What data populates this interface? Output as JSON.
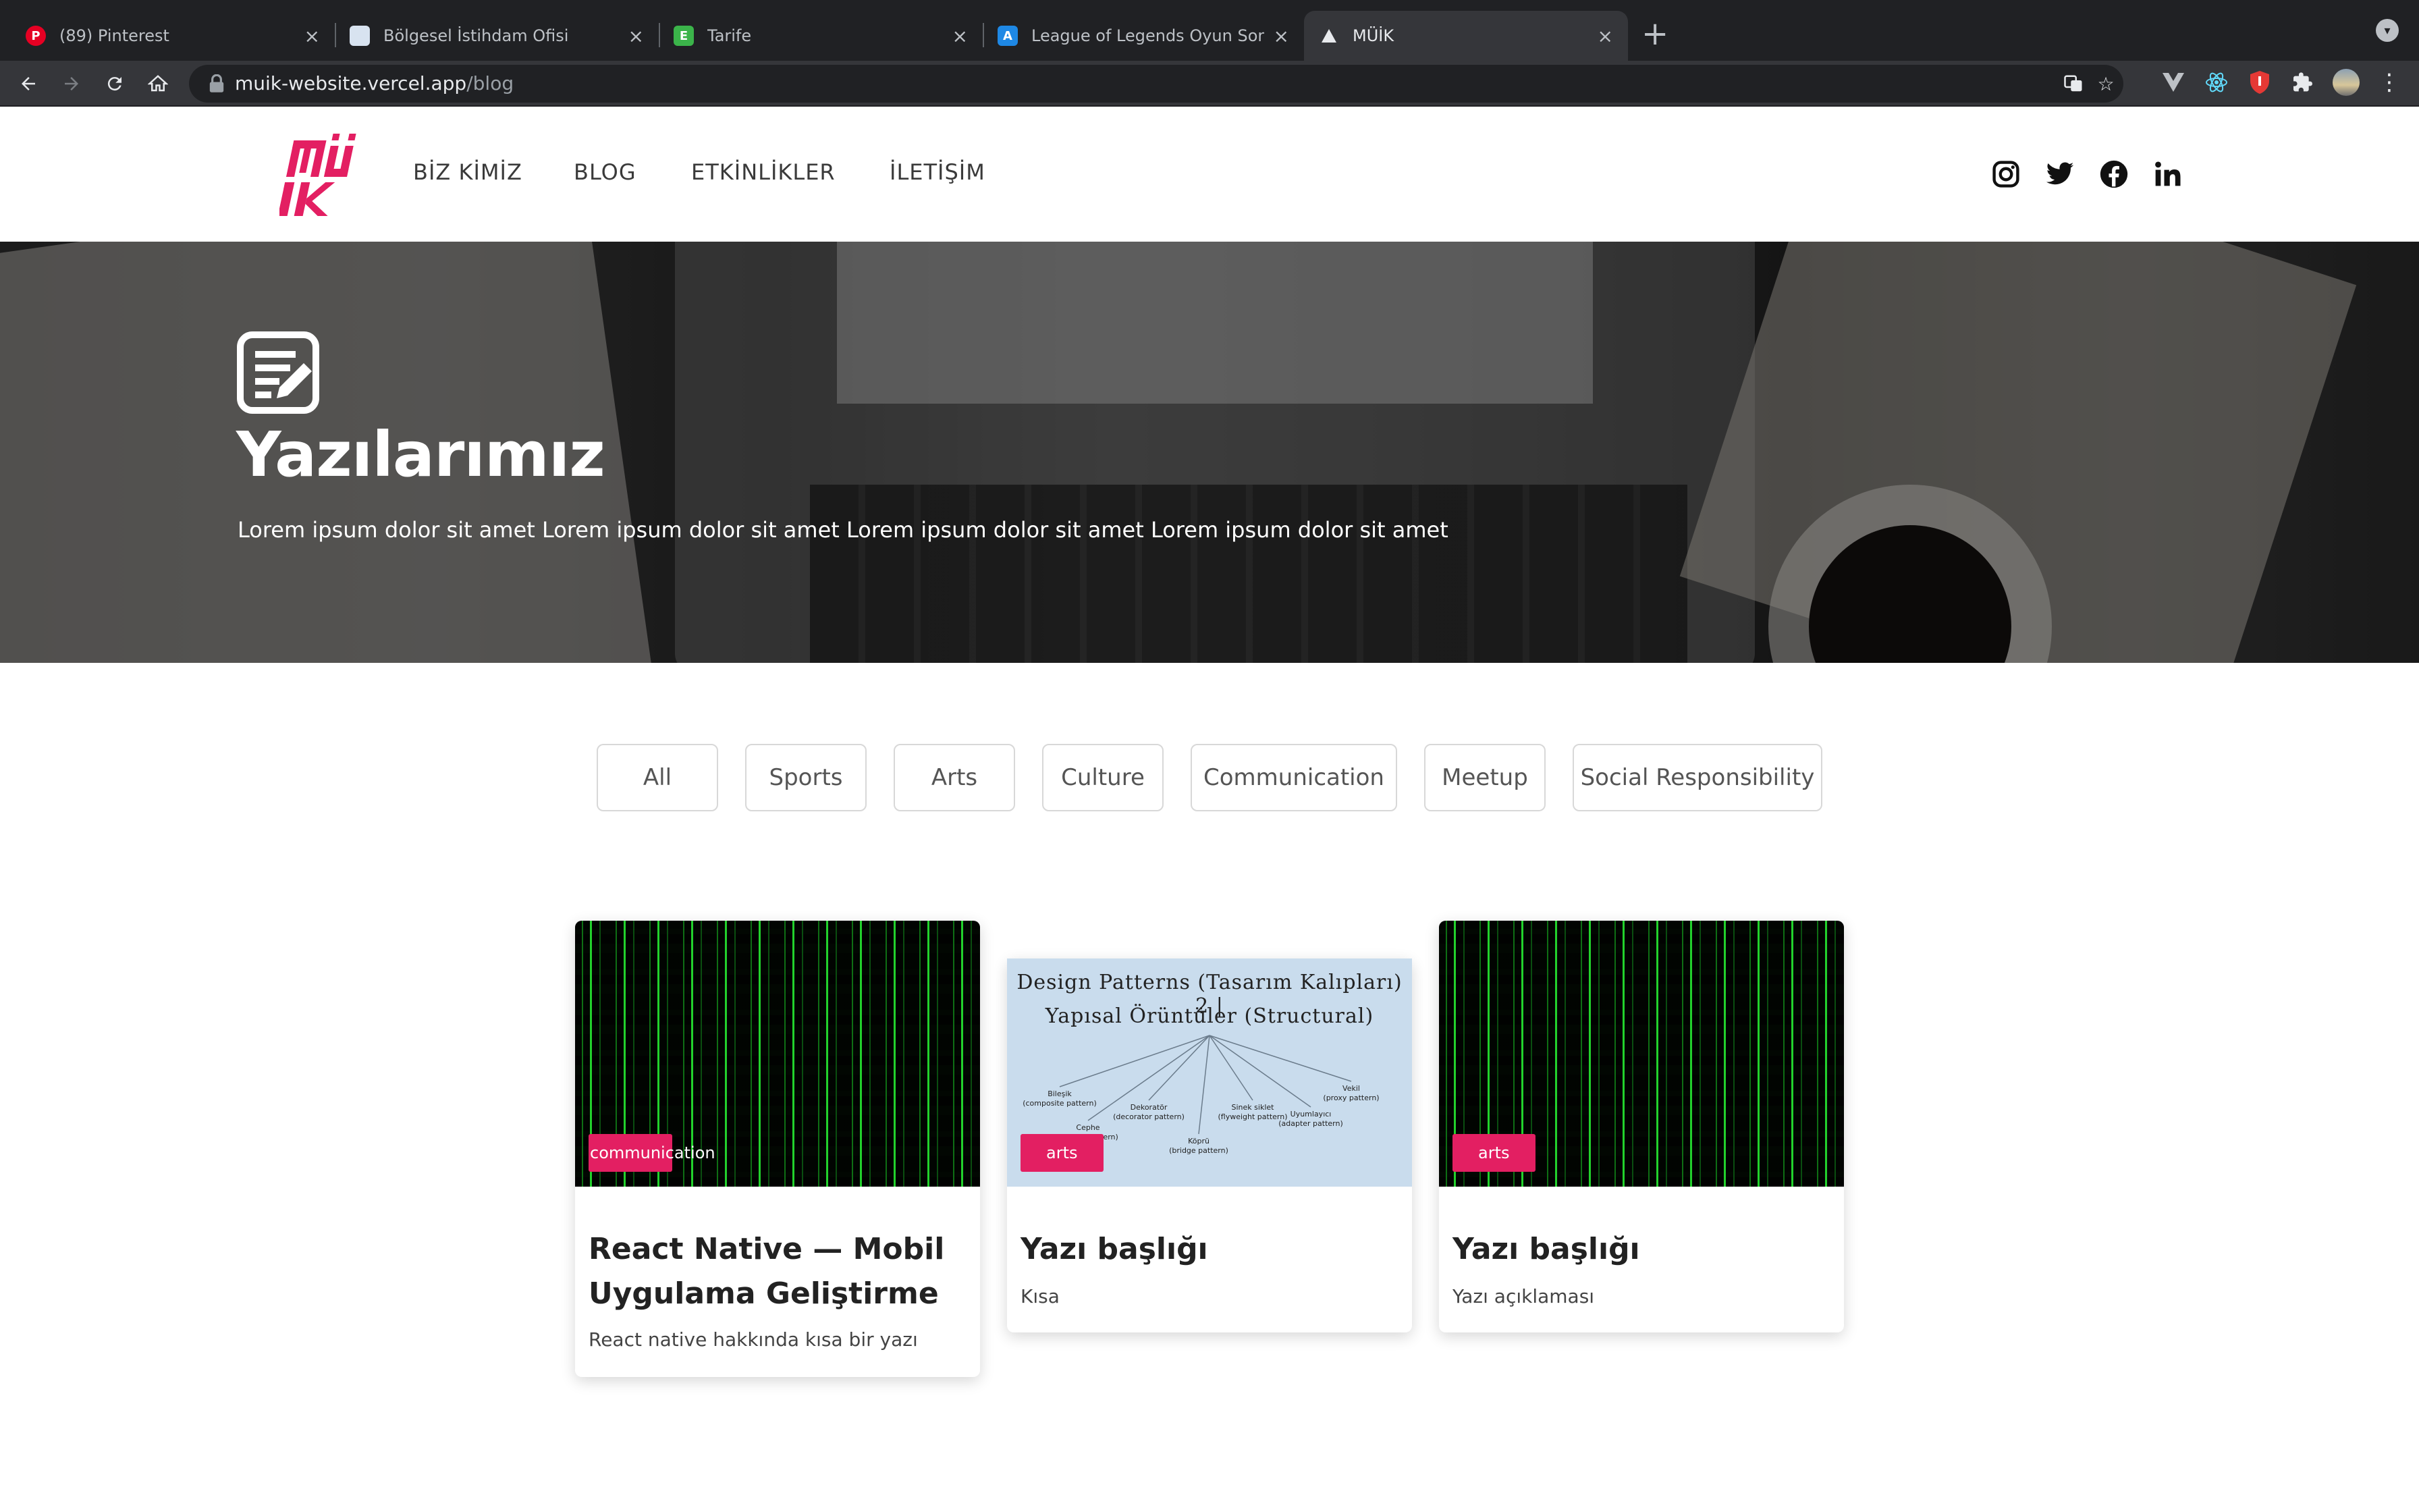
{
  "browser": {
    "tabs": [
      {
        "title": "(89) Pinterest",
        "favicon": "pinterest-icon",
        "color": "#e60023"
      },
      {
        "title": "Bölgesel İstihdam Ofisi",
        "favicon": "office-icon",
        "color": "#d8e3f0"
      },
      {
        "title": "Tarife",
        "favicon": "e-icon",
        "color": "#3bb44a"
      },
      {
        "title": "League of Legends Oyun Sonrası",
        "favicon": "lol-icon",
        "color": "#1e88e5"
      },
      {
        "title": "MÜİK",
        "favicon": "vercel-icon",
        "color": "#000000"
      }
    ],
    "new_tab_label": "+",
    "url_host": "muik-website.vercel.app",
    "url_path": "/blog"
  },
  "site": {
    "brand_color": "#e31f62",
    "logo_alt": "MÜİK logo",
    "nav": [
      "BİZ KİMİZ",
      "BLOG",
      "ETKİNLİKLER",
      "İLETİŞİM"
    ],
    "social": [
      "instagram-icon",
      "twitter-icon",
      "facebook-icon",
      "linkedin-icon"
    ]
  },
  "hero": {
    "title": "Yazılarımız",
    "subtitle": "Lorem ipsum dolor sit amet Lorem ipsum dolor sit amet Lorem ipsum dolor sit amet Lorem ipsum dolor sit amet"
  },
  "filters": [
    "All",
    "Sports",
    "Arts",
    "Culture",
    "Communication",
    "Meetup",
    "Social Responsibility"
  ],
  "posts": [
    {
      "tag": "communication",
      "title": "React Native — Mobil Uygulama Geliştirme",
      "description": "React native hakkında kısa bir yazı",
      "image": "matrix-code"
    },
    {
      "tag": "arts",
      "title": "Yazı başlığı",
      "description": "Kısa",
      "image": "design-patterns",
      "image_text": {
        "heading_line1": "Design Patterns (Tasarım Kalıpları) 2 |",
        "heading_line2": "Yapısal Örüntüler (Structural)",
        "nodes": [
          "Bileşik",
          "(composite pattern)",
          "Dekoratör",
          "(decorator pattern)",
          "Cephe",
          "(facade pattern)",
          "Köprü",
          "(bridge pattern)",
          "Sinek siklet",
          "(flyweight pattern)",
          "Uyumlayıcı",
          "(adapter pattern)",
          "Vekil",
          "(proxy pattern)"
        ]
      }
    },
    {
      "tag": "arts",
      "title": "Yazı başlığı",
      "description": "Yazı açıklaması",
      "image": "matrix-code"
    }
  ]
}
